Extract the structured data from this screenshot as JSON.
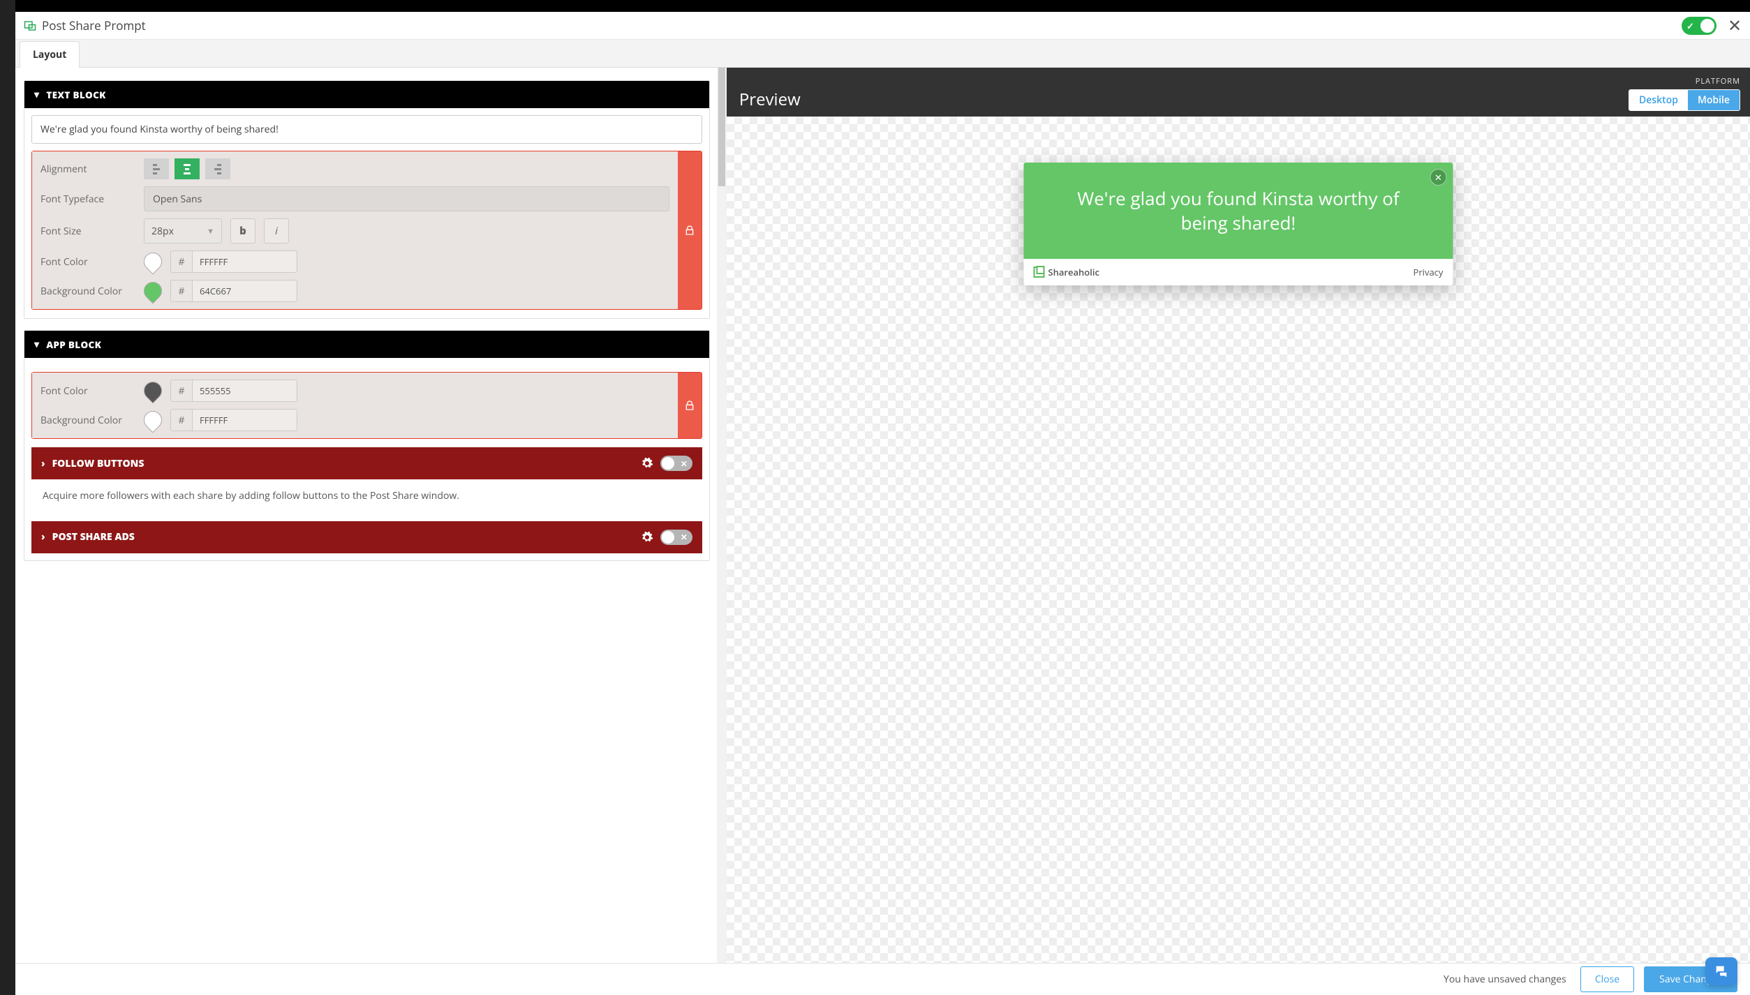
{
  "header": {
    "title": "Post Share Prompt"
  },
  "tabs": {
    "layout": "Layout"
  },
  "text_block": {
    "heading": "TEXT BLOCK",
    "text_value": "We're glad you found Kinsta worthy of being shared!",
    "alignment_label": "Alignment",
    "typeface_label": "Font Typeface",
    "typeface_value": "Open Sans",
    "size_label": "Font Size",
    "size_value": "28px",
    "bold_label": "b",
    "italic_label": "i",
    "font_color_label": "Font Color",
    "font_color_value": "FFFFFF",
    "bg_color_label": "Background Color",
    "bg_color_value": "64C667",
    "hash": "#"
  },
  "app_block": {
    "heading": "APP BLOCK",
    "font_color_label": "Font Color",
    "font_color_value": "555555",
    "bg_color_label": "Background Color",
    "bg_color_value": "FFFFFF",
    "hash": "#"
  },
  "follow_buttons": {
    "heading": "FOLLOW BUTTONS",
    "desc": "Acquire more followers with each share by adding follow buttons to the Post Share window."
  },
  "post_share_ads": {
    "heading": "POST SHARE ADS"
  },
  "preview": {
    "title": "Preview",
    "platform_label": "PLATFORM",
    "desktop": "Desktop",
    "mobile": "Mobile",
    "message": "We're glad you found Kinsta worthy of being shared!",
    "brand": "Shareaholic",
    "privacy": "Privacy"
  },
  "footer": {
    "unsaved": "You have unsaved changes",
    "close": "Close",
    "save": "Save Changes"
  }
}
